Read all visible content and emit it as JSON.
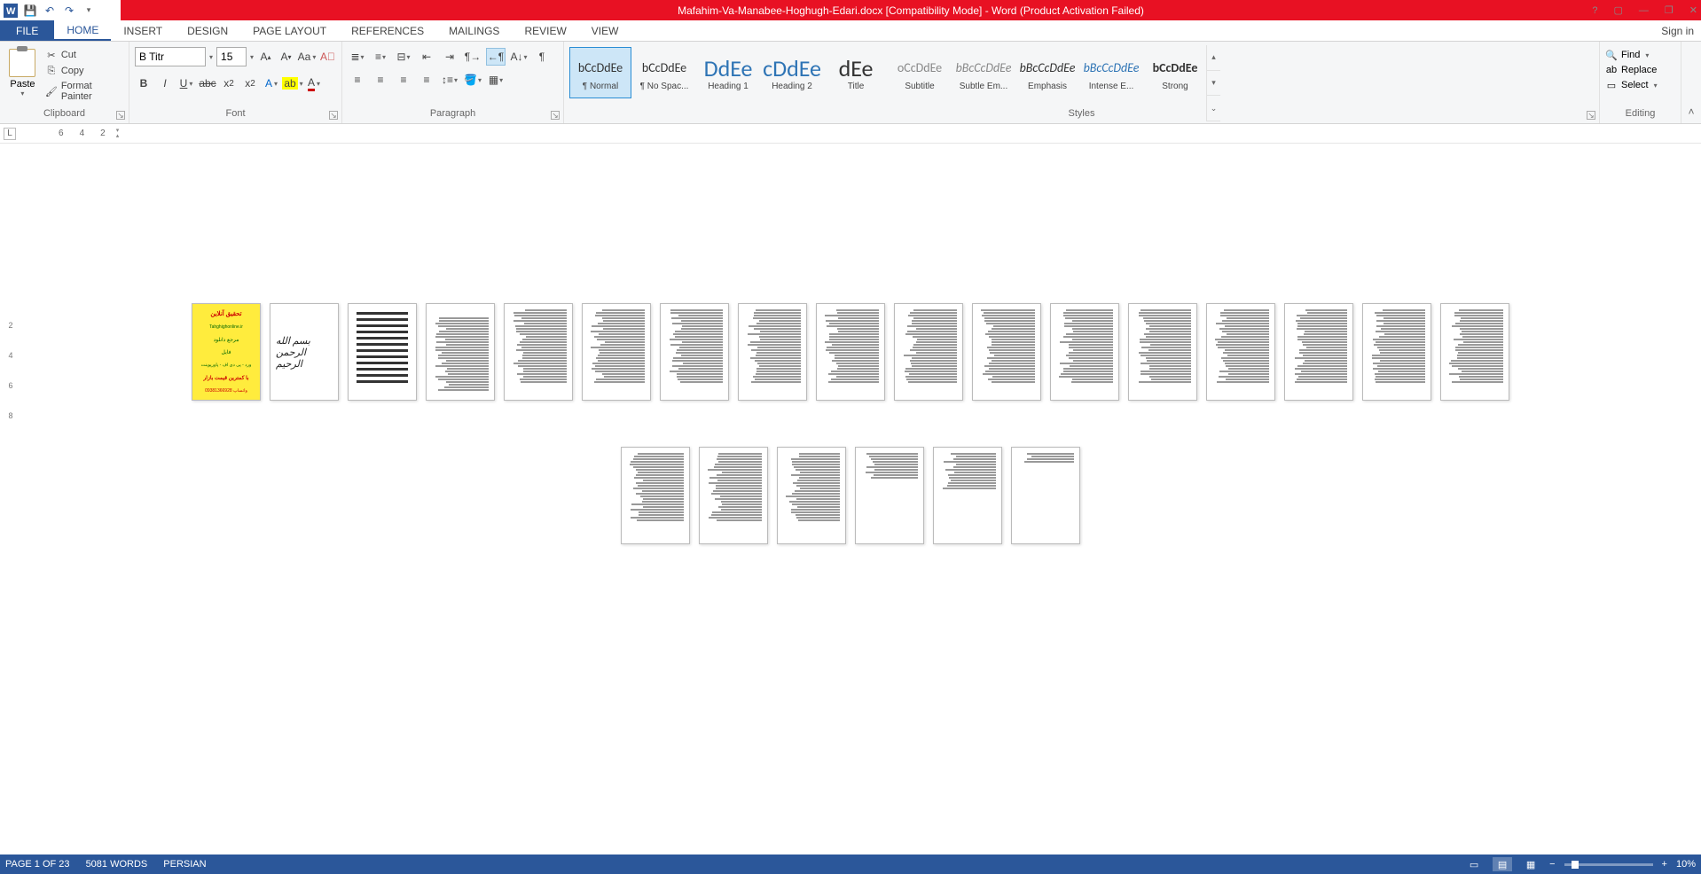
{
  "titlebar": {
    "title": "Mafahim-Va-Manabee-Hoghugh-Edari.docx [Compatibility Mode] - Word (Product Activation Failed)"
  },
  "window": {
    "help": "?",
    "ribbon_opts": "▢",
    "minimize": "—",
    "restore": "❐",
    "close": "✕"
  },
  "tabs": {
    "file": "FILE",
    "home": "HOME",
    "insert": "INSERT",
    "design": "DESIGN",
    "page_layout": "PAGE LAYOUT",
    "references": "REFERENCES",
    "mailings": "MAILINGS",
    "review": "REVIEW",
    "view": "VIEW",
    "signin": "Sign in"
  },
  "clipboard": {
    "paste": "Paste",
    "cut": "Cut",
    "copy": "Copy",
    "format_painter": "Format Painter",
    "label": "Clipboard"
  },
  "font": {
    "name": "B Titr",
    "size": "15",
    "label": "Font"
  },
  "paragraph": {
    "label": "Paragraph"
  },
  "styles": {
    "label": "Styles",
    "items": [
      {
        "preview": "bCcDdEe",
        "name": "¶ Normal",
        "cls": ""
      },
      {
        "preview": "bCcDdEe",
        "name": "¶ No Spac...",
        "cls": ""
      },
      {
        "preview": "DdEe",
        "name": "Heading 1",
        "cls": "big",
        "color": "#2e74b5"
      },
      {
        "preview": "cDdEe",
        "name": "Heading 2",
        "cls": "big",
        "color": "#2e74b5"
      },
      {
        "preview": "dEe",
        "name": "Title",
        "cls": "big"
      },
      {
        "preview": "oCcDdEe",
        "name": "Subtitle",
        "cls": "",
        "color": "#888"
      },
      {
        "preview": "bBcCcDdEe",
        "name": "Subtle Em...",
        "cls": "",
        "style": "italic",
        "color": "#888"
      },
      {
        "preview": "bBcCcDdEe",
        "name": "Emphasis",
        "cls": "",
        "style": "italic"
      },
      {
        "preview": "bBcCcDdEe",
        "name": "Intense E...",
        "cls": "",
        "style": "italic",
        "color": "#2e74b5"
      },
      {
        "preview": "bCcDdEe",
        "name": "Strong",
        "cls": "",
        "weight": "bold"
      }
    ]
  },
  "editing": {
    "find": "Find",
    "replace": "Replace",
    "select": "Select",
    "label": "Editing"
  },
  "ruler": {
    "tabstop": "L",
    "marks": [
      "6",
      "4",
      "2"
    ]
  },
  "vruler": [
    "2",
    "4",
    "6",
    "8"
  ],
  "cover": {
    "t1": "تحقیق آنلاین",
    "site": "Tahghighonline.ir",
    "t2": "مرجع دانلود",
    "t3": "فایل",
    "t4": "ورد - پی دی اف - پاورپوینت",
    "t5": "با کمترین قیمت بازار",
    "t6": "09381366928 واتساپ"
  },
  "bismillah": "بسم الله الرحمن الرحیم",
  "status": {
    "page": "PAGE 1 OF 23",
    "words": "5081 WORDS",
    "lang": "PERSIAN",
    "zoom": "10%"
  }
}
